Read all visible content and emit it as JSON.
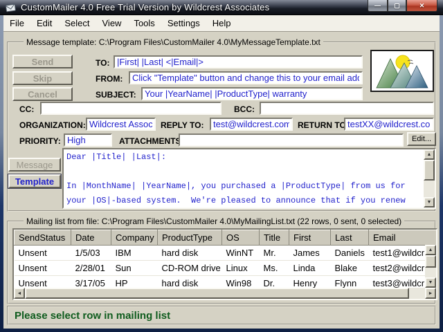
{
  "window": {
    "title": "CustomMailer 4.0 Free Trial Version by Wildcrest Associates",
    "minimize": "—",
    "maximize": "▢",
    "close": "✕"
  },
  "menu": {
    "items": [
      "File",
      "Edit",
      "Select",
      "View",
      "Tools",
      "Settings",
      "Help"
    ]
  },
  "template_section": {
    "label": "Message template: C:\\Program Files\\CustomMailer 4.0\\MyMessageTemplate.txt",
    "send_button": "Send",
    "skip_button": "Skip",
    "cancel_button": "Cancel",
    "fields": {
      "to_label": "TO:",
      "to": "|First| |Last| <|Email|>",
      "from_label": "FROM:",
      "from": "Click \"Template\" button and change this to your email address",
      "subject_label": "SUBJECT:",
      "subject": "Your |YearName| |ProductType| warranty",
      "cc_label": "CC:",
      "cc": "",
      "bcc_label": "BCC:",
      "bcc": "",
      "organization_label": "ORGANIZATION:",
      "organization": "Wildcrest Associat",
      "reply_to_label": "REPLY TO:",
      "reply_to": "test@wildcrest.com",
      "return_to_label": "RETURN TO:",
      "return_to": "testXX@wildcrest.com",
      "priority_label": "PRIORITY:",
      "priority": "High",
      "attachments_label": "ATTACHMENTS:",
      "attachments": "",
      "edit_button": "Edit..."
    },
    "message_view_button": "Message",
    "template_view_button": "Template",
    "message_body": "Dear |Title| |Last|:\n\nIn |MonthName| |YearName|, you purchased a |ProductType| from us for\nyour |OS|-based system.  We're pleased to announce that if you renew\nyour |ProductType| warranty by |MonthName| |DayName| of this year,"
  },
  "mailing_list": {
    "label": "Mailing list from file: C:\\Program Files\\CustomMailer 4.0\\MyMailingList.txt (22 rows, 0 sent, 0 selected)",
    "columns": [
      "SendStatus",
      "Date",
      "Company",
      "ProductType",
      "OS",
      "Title",
      "First",
      "Last",
      "Email"
    ],
    "rows": [
      [
        "Unsent",
        "1/5/03",
        "IBM",
        "hard disk",
        "WinNT",
        "Mr.",
        "James",
        "Daniels",
        "test1@wildcr"
      ],
      [
        "Unsent",
        "2/28/01",
        "Sun",
        "CD-ROM drive",
        "Linux",
        "Ms.",
        "Linda",
        "Blake",
        "test2@wildcr"
      ],
      [
        "Unsent",
        "3/17/05",
        "HP",
        "hard disk",
        "Win98",
        "Dr.",
        "Henry",
        "Flynn",
        "test3@wildcr"
      ]
    ]
  },
  "status": {
    "message": "Please select row in mailing list"
  },
  "colors": {
    "field_text_blue": "#2222cc",
    "status_green": "#0f5c1e",
    "close_button_red": "#b03320",
    "client_background": "#d5d2c4"
  }
}
